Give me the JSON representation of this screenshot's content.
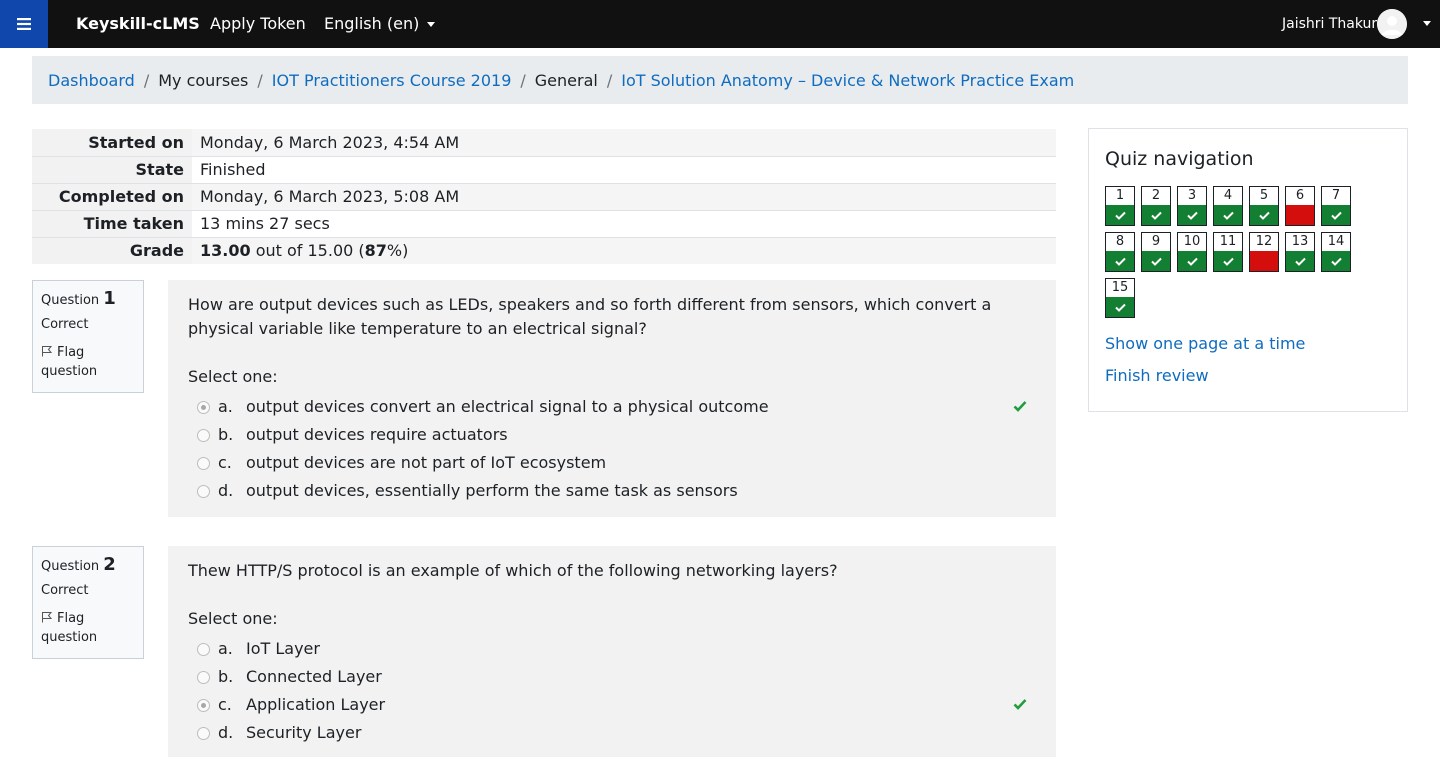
{
  "navbar": {
    "brand": "Keyskill-cLMS",
    "apply_token": "Apply Token",
    "language": "English (en)",
    "user_name": "Jaishri Thakur"
  },
  "breadcrumb": {
    "items": [
      {
        "label": "Dashboard",
        "link": true
      },
      {
        "label": "My courses",
        "link": false
      },
      {
        "label": "IOT Practitioners Course 2019",
        "link": true
      },
      {
        "label": "General",
        "link": false
      },
      {
        "label": "IoT Solution Anatomy – Device & Network Practice Exam",
        "link": true
      }
    ]
  },
  "summary": {
    "started_label": "Started on",
    "started_value": "Monday, 6 March 2023, 4:54 AM",
    "state_label": "State",
    "state_value": "Finished",
    "completed_label": "Completed on",
    "completed_value": "Monday, 6 March 2023, 5:08 AM",
    "time_label": "Time taken",
    "time_value": "13 mins 27 secs",
    "grade_label": "Grade",
    "grade_score": "13.00",
    "grade_out_of": " out of 15.00 (",
    "grade_percent": "87",
    "grade_suffix": "%)"
  },
  "questions": [
    {
      "word": "Question",
      "number": "1",
      "state": "Correct",
      "flag": "Flag question",
      "text": "How are output devices such as LEDs, speakers and so forth different from sensors, which convert a physical variable like temperature to an electrical signal?",
      "prompt": "Select one:",
      "answers": [
        {
          "letter": "a.",
          "text": "output devices convert an electrical signal to a physical outcome",
          "checked": true
        },
        {
          "letter": "b.",
          "text": "output devices require actuators",
          "checked": false
        },
        {
          "letter": "c.",
          "text": "output devices are not part of IoT ecosystem",
          "checked": false
        },
        {
          "letter": "d.",
          "text": "output devices, essentially perform the same task as sensors",
          "checked": false
        }
      ]
    },
    {
      "word": "Question",
      "number": "2",
      "state": "Correct",
      "flag": "Flag question",
      "text": "Thew HTTP/S protocol is an example of which of the following networking layers?",
      "prompt": "Select one:",
      "answers": [
        {
          "letter": "a.",
          "text": "IoT Layer",
          "checked": false
        },
        {
          "letter": "b.",
          "text": "Connected Layer",
          "checked": false
        },
        {
          "letter": "c.",
          "text": "Application Layer",
          "checked": true
        },
        {
          "letter": "d.",
          "text": "Security Layer",
          "checked": false
        }
      ]
    }
  ],
  "quiz_nav": {
    "title": "Quiz navigation",
    "buttons": [
      {
        "label": "1",
        "status": "correct"
      },
      {
        "label": "2",
        "status": "correct"
      },
      {
        "label": "3",
        "status": "correct"
      },
      {
        "label": "4",
        "status": "correct"
      },
      {
        "label": "5",
        "status": "correct"
      },
      {
        "label": "6",
        "status": "incorrect"
      },
      {
        "label": "7",
        "status": "correct"
      },
      {
        "label": "8",
        "status": "correct"
      },
      {
        "label": "9",
        "status": "correct"
      },
      {
        "label": "10",
        "status": "correct"
      },
      {
        "label": "11",
        "status": "correct"
      },
      {
        "label": "12",
        "status": "incorrect"
      },
      {
        "label": "13",
        "status": "correct"
      },
      {
        "label": "14",
        "status": "correct"
      },
      {
        "label": "15",
        "status": "correct"
      }
    ],
    "show_one_page": "Show one page at a time",
    "finish_review": "Finish review"
  },
  "colors": {
    "navbar_bg": "#111111",
    "menu_button_bg": "#0f47ad",
    "link": "#0f6cbf",
    "correct": "#137f33",
    "incorrect": "#d40d0d",
    "check_mark": "#1f9e3f"
  },
  "icons": {
    "menu": "hamburger-icon",
    "user_caret": "chevron-down-icon",
    "flag": "flag-icon",
    "correct": "checkmark-icon"
  }
}
